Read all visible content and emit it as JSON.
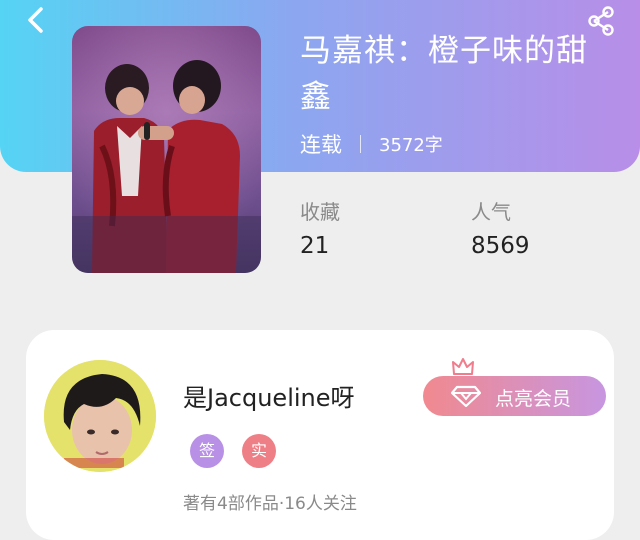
{
  "nav": {
    "back_icon": "chevron-left-icon",
    "share_icon": "share-icon"
  },
  "book": {
    "title": "马嘉祺：橙子味的甜鑫",
    "status": "连载",
    "word_count": "3572字",
    "cover_icon": "book-cover-image"
  },
  "stats": [
    {
      "label": "收藏",
      "value": "21"
    },
    {
      "label": "人气",
      "value": "8569"
    }
  ],
  "author": {
    "name": "是Jacqueline呀",
    "avatar_icon": "author-avatar-image",
    "badges": [
      {
        "label": "签",
        "color": "#b891e6"
      },
      {
        "label": "实",
        "color": "#ef7f86"
      }
    ],
    "works_info": "著有4部作品·16人关注"
  },
  "vip": {
    "label": "点亮会员",
    "crown_icon": "crown-icon",
    "diamond_icon": "diamond-icon"
  },
  "colors": {
    "header_gradient_start": "#55d4f4",
    "header_gradient_end": "#b88ee8",
    "vip_gradient_start": "#f1898f",
    "vip_gradient_end": "#c796e0"
  }
}
